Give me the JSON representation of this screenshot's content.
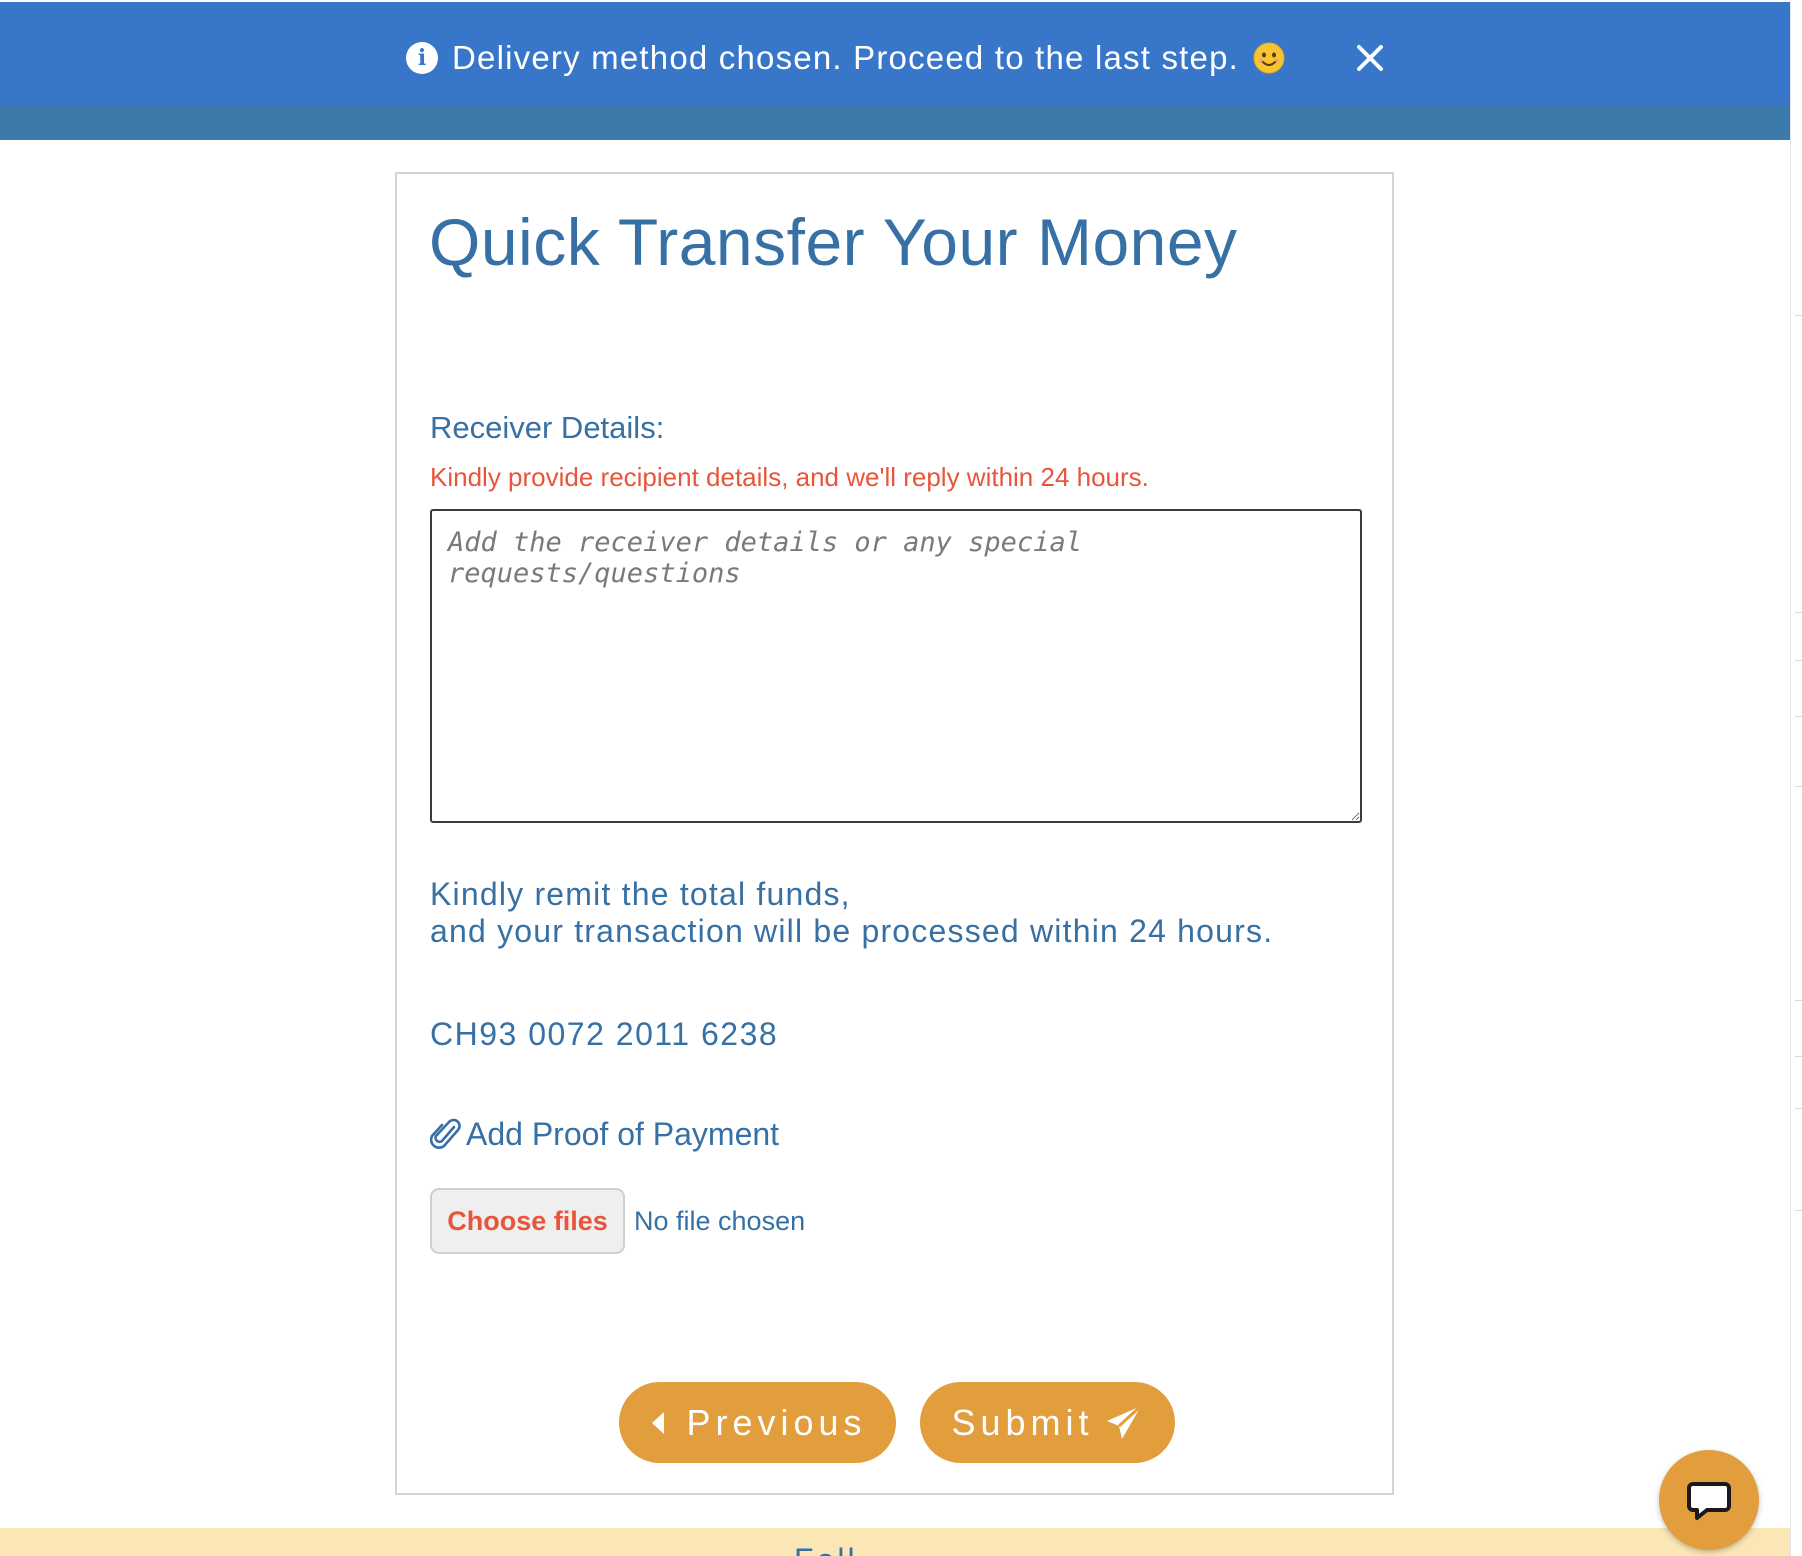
{
  "notice": {
    "message": "Delivery method chosen. Proceed to the last step.",
    "bg_color": "#3876c9",
    "icons": {
      "info": "info-circle-icon",
      "emoji": "smiling-face-icon",
      "close": "close-icon"
    }
  },
  "form": {
    "title": "Quick Transfer Your Money",
    "receiver_label": "Receiver Details:",
    "receiver_note": "Kindly provide recipient details, and we'll reply within 24 hours.",
    "details_placeholder": "Add the receiver details or any special requests/questions",
    "details_value": "",
    "remit_line1": "Kindly remit the total funds,",
    "remit_line2": "and your transaction will be processed within 24 hours.",
    "account_number": "CH93 0072 2011 6238",
    "proof_label": "Add Proof of Payment",
    "choose_files_label": "Choose files",
    "no_file_label": "No file chosen",
    "previous_label": "Previous",
    "submit_label": "Submit"
  },
  "footer": {
    "text": "Foll"
  },
  "colors": {
    "accent": "#e29d3c",
    "text_blue": "#3770a5",
    "warning_red": "#e8553a",
    "footer_bg": "#fbe7b5"
  },
  "chat": {
    "icon": "chat-bubble-icon"
  }
}
